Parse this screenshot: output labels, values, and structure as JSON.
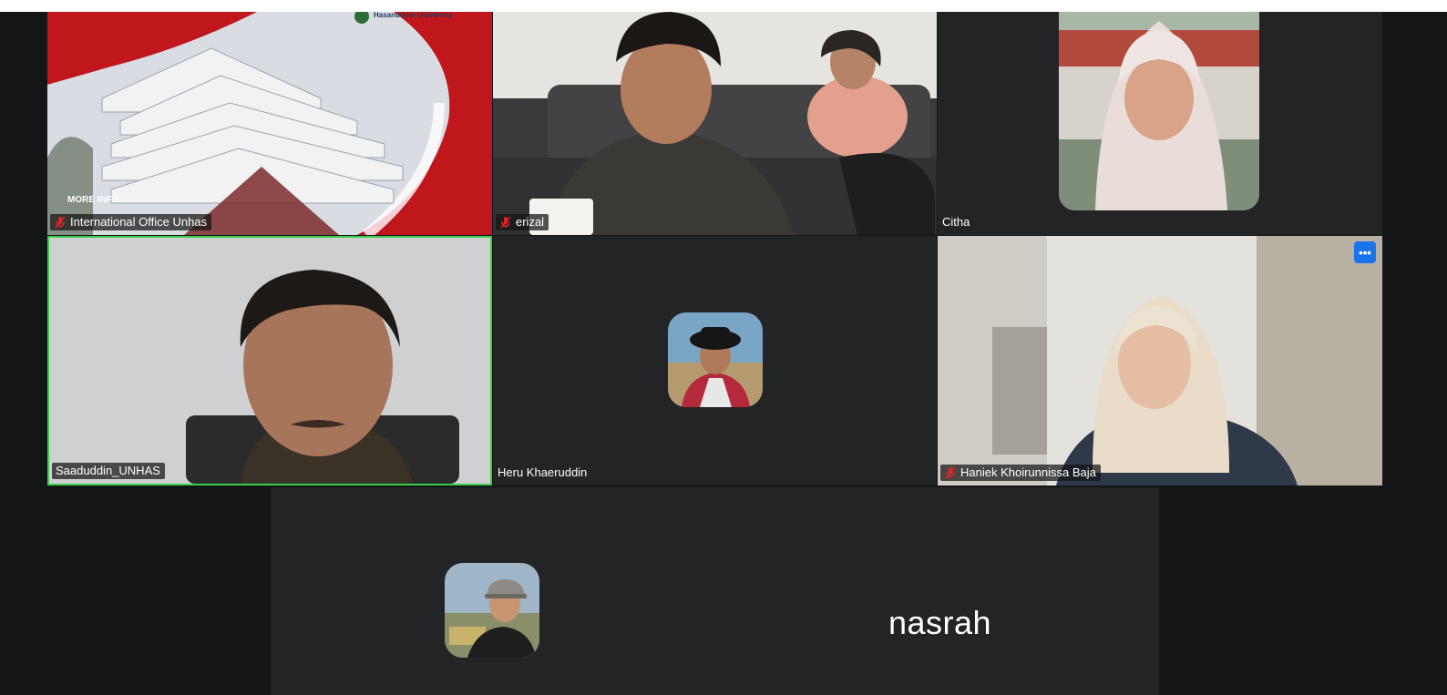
{
  "participants": [
    {
      "name": "International Office Unhas",
      "muted": true
    },
    {
      "name": "erizal",
      "muted": true
    },
    {
      "name": "Citha",
      "muted": false
    },
    {
      "name": "Saaduddin_UNHAS",
      "muted": false,
      "active_speaker": true
    },
    {
      "name": "Heru  Khaeruddin",
      "muted": false
    },
    {
      "name": "Haniek Khoirunnissa Baja",
      "muted": true
    },
    {
      "name": "nasrah",
      "muted": false
    }
  ],
  "share_overlay": {
    "brand": "Hasanuddin University",
    "more_info": "MORE INFO"
  },
  "tile_menu": {
    "label": "•••",
    "icon": "more-options-icon"
  },
  "colors": {
    "active_speaker_border": "#3ecf4a",
    "mute_icon": "#e02424",
    "menu_button": "#1a73e8",
    "tile_background": "#232425"
  }
}
